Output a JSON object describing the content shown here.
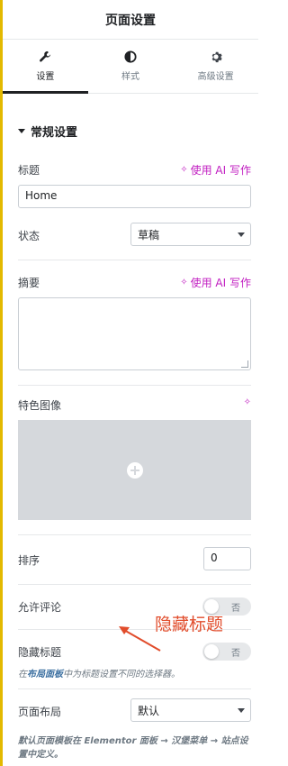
{
  "header": {
    "title": "页面设置"
  },
  "tabs": [
    {
      "label": "设置",
      "icon": "wrench-icon"
    },
    {
      "label": "样式",
      "icon": "half-circle-icon"
    },
    {
      "label": "高级设置",
      "icon": "gear-icon"
    }
  ],
  "section": {
    "title": "常规设置"
  },
  "fields": {
    "title_label": "标题",
    "title_value": "Home",
    "ai_write": "使用 AI 写作",
    "status_label": "状态",
    "status_value": "草稿",
    "excerpt_label": "摘要",
    "featured_label": "特色图像",
    "order_label": "排序",
    "order_value": "0",
    "comments_label": "允许评论",
    "comments_toggle": "否",
    "hide_title_label": "隐藏标题",
    "hide_title_toggle": "否",
    "hide_title_note_pre": "在",
    "hide_title_note_link": "布局面板",
    "hide_title_note_post": "中为标题设置不同的选择器。",
    "layout_label": "页面布局",
    "layout_value": "默认",
    "layout_note": "默认页面模板在 Elementor 面板 → 汉堡菜单 → 站点设置中定义。"
  },
  "annotation": {
    "text": "隐藏标题",
    "color": "#e14c2b"
  },
  "colors": {
    "accent": "#c11dc1",
    "left_bar": "#e3b900"
  }
}
